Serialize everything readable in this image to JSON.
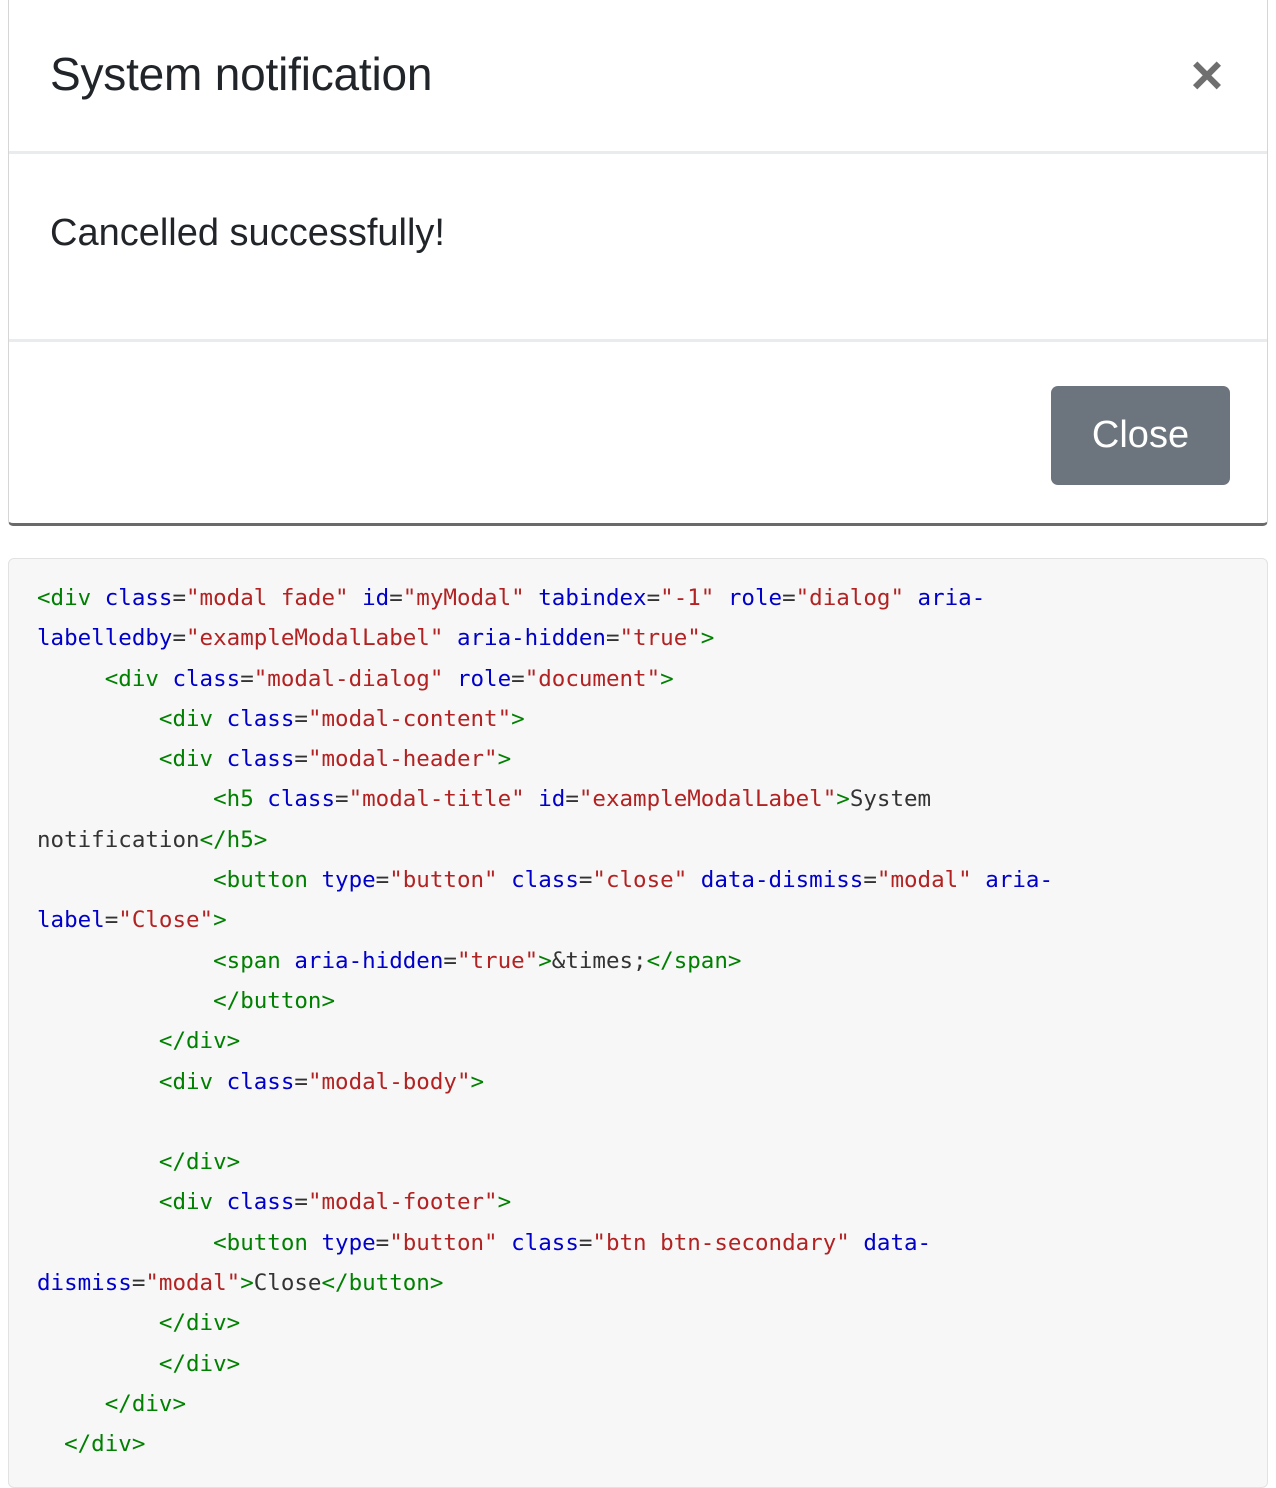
{
  "modal": {
    "title": "System notification",
    "close_icon": "×",
    "body_text": "Cancelled successfully!",
    "footer_button": "Close"
  },
  "code": {
    "lines": [
      [
        [
          "t",
          "<div "
        ],
        [
          "a",
          "class"
        ],
        [
          "e",
          "="
        ],
        [
          "v",
          "\"modal fade\""
        ],
        [
          "e",
          " "
        ],
        [
          "a",
          "id"
        ],
        [
          "e",
          "="
        ],
        [
          "v",
          "\"myModal\""
        ],
        [
          "e",
          " "
        ],
        [
          "a",
          "tabindex"
        ],
        [
          "e",
          "="
        ],
        [
          "v",
          "\"-1\""
        ],
        [
          "e",
          " "
        ],
        [
          "a",
          "role"
        ],
        [
          "e",
          "="
        ],
        [
          "v",
          "\"dialog\""
        ],
        [
          "e",
          " "
        ],
        [
          "a",
          "aria-"
        ]
      ],
      [
        [
          "a",
          "labelledby"
        ],
        [
          "e",
          "="
        ],
        [
          "v",
          "\"exampleModalLabel\""
        ],
        [
          "e",
          " "
        ],
        [
          "a",
          "aria-hidden"
        ],
        [
          "e",
          "="
        ],
        [
          "v",
          "\"true\""
        ],
        [
          "t",
          ">"
        ]
      ],
      [
        [
          "e",
          "     "
        ],
        [
          "t",
          "<div "
        ],
        [
          "a",
          "class"
        ],
        [
          "e",
          "="
        ],
        [
          "v",
          "\"modal-dialog\""
        ],
        [
          "e",
          " "
        ],
        [
          "a",
          "role"
        ],
        [
          "e",
          "="
        ],
        [
          "v",
          "\"document\""
        ],
        [
          "t",
          ">"
        ]
      ],
      [
        [
          "e",
          "         "
        ],
        [
          "t",
          "<div "
        ],
        [
          "a",
          "class"
        ],
        [
          "e",
          "="
        ],
        [
          "v",
          "\"modal-content\""
        ],
        [
          "t",
          ">"
        ]
      ],
      [
        [
          "e",
          "         "
        ],
        [
          "t",
          "<div "
        ],
        [
          "a",
          "class"
        ],
        [
          "e",
          "="
        ],
        [
          "v",
          "\"modal-header\""
        ],
        [
          "t",
          ">"
        ]
      ],
      [
        [
          "e",
          "             "
        ],
        [
          "t",
          "<h5 "
        ],
        [
          "a",
          "class"
        ],
        [
          "e",
          "="
        ],
        [
          "v",
          "\"modal-title\""
        ],
        [
          "e",
          " "
        ],
        [
          "a",
          "id"
        ],
        [
          "e",
          "="
        ],
        [
          "v",
          "\"exampleModalLabel\""
        ],
        [
          "t",
          ">"
        ],
        [
          "x",
          "System"
        ]
      ],
      [
        [
          "x",
          "notification"
        ],
        [
          "t",
          "</h5>"
        ]
      ],
      [
        [
          "e",
          "             "
        ],
        [
          "t",
          "<button "
        ],
        [
          "a",
          "type"
        ],
        [
          "e",
          "="
        ],
        [
          "v",
          "\"button\""
        ],
        [
          "e",
          " "
        ],
        [
          "a",
          "class"
        ],
        [
          "e",
          "="
        ],
        [
          "v",
          "\"close\""
        ],
        [
          "e",
          " "
        ],
        [
          "a",
          "data-dismiss"
        ],
        [
          "e",
          "="
        ],
        [
          "v",
          "\"modal\""
        ],
        [
          "e",
          " "
        ],
        [
          "a",
          "aria-"
        ]
      ],
      [
        [
          "a",
          "label"
        ],
        [
          "e",
          "="
        ],
        [
          "v",
          "\"Close\""
        ],
        [
          "t",
          ">"
        ]
      ],
      [
        [
          "e",
          "             "
        ],
        [
          "t",
          "<span "
        ],
        [
          "a",
          "aria-hidden"
        ],
        [
          "e",
          "="
        ],
        [
          "v",
          "\"true\""
        ],
        [
          "t",
          ">"
        ],
        [
          "x",
          "&times;"
        ],
        [
          "t",
          "</span>"
        ]
      ],
      [
        [
          "e",
          "             "
        ],
        [
          "t",
          "</button>"
        ]
      ],
      [
        [
          "e",
          "         "
        ],
        [
          "t",
          "</div>"
        ]
      ],
      [
        [
          "e",
          "         "
        ],
        [
          "t",
          "<div "
        ],
        [
          "a",
          "class"
        ],
        [
          "e",
          "="
        ],
        [
          "v",
          "\"modal-body\""
        ],
        [
          "t",
          ">"
        ]
      ],
      [
        [
          "e",
          ""
        ]
      ],
      [
        [
          "e",
          "         "
        ],
        [
          "t",
          "</div>"
        ]
      ],
      [
        [
          "e",
          "         "
        ],
        [
          "t",
          "<div "
        ],
        [
          "a",
          "class"
        ],
        [
          "e",
          "="
        ],
        [
          "v",
          "\"modal-footer\""
        ],
        [
          "t",
          ">"
        ]
      ],
      [
        [
          "e",
          "             "
        ],
        [
          "t",
          "<button "
        ],
        [
          "a",
          "type"
        ],
        [
          "e",
          "="
        ],
        [
          "v",
          "\"button\""
        ],
        [
          "e",
          " "
        ],
        [
          "a",
          "class"
        ],
        [
          "e",
          "="
        ],
        [
          "v",
          "\"btn btn-secondary\""
        ],
        [
          "e",
          " "
        ],
        [
          "a",
          "data-"
        ]
      ],
      [
        [
          "a",
          "dismiss"
        ],
        [
          "e",
          "="
        ],
        [
          "v",
          "\"modal\""
        ],
        [
          "t",
          ">"
        ],
        [
          "x",
          "Close"
        ],
        [
          "t",
          "</button>"
        ]
      ],
      [
        [
          "e",
          "         "
        ],
        [
          "t",
          "</div>"
        ]
      ],
      [
        [
          "e",
          "         "
        ],
        [
          "t",
          "</div>"
        ]
      ],
      [
        [
          "e",
          "     "
        ],
        [
          "t",
          "</div>"
        ]
      ],
      [
        [
          "e",
          "  "
        ],
        [
          "t",
          "</div>"
        ]
      ]
    ]
  },
  "colors": {
    "button_bg": "#6c757d",
    "tag": "#008000",
    "attr": "#0000c8",
    "value": "#b22222"
  }
}
